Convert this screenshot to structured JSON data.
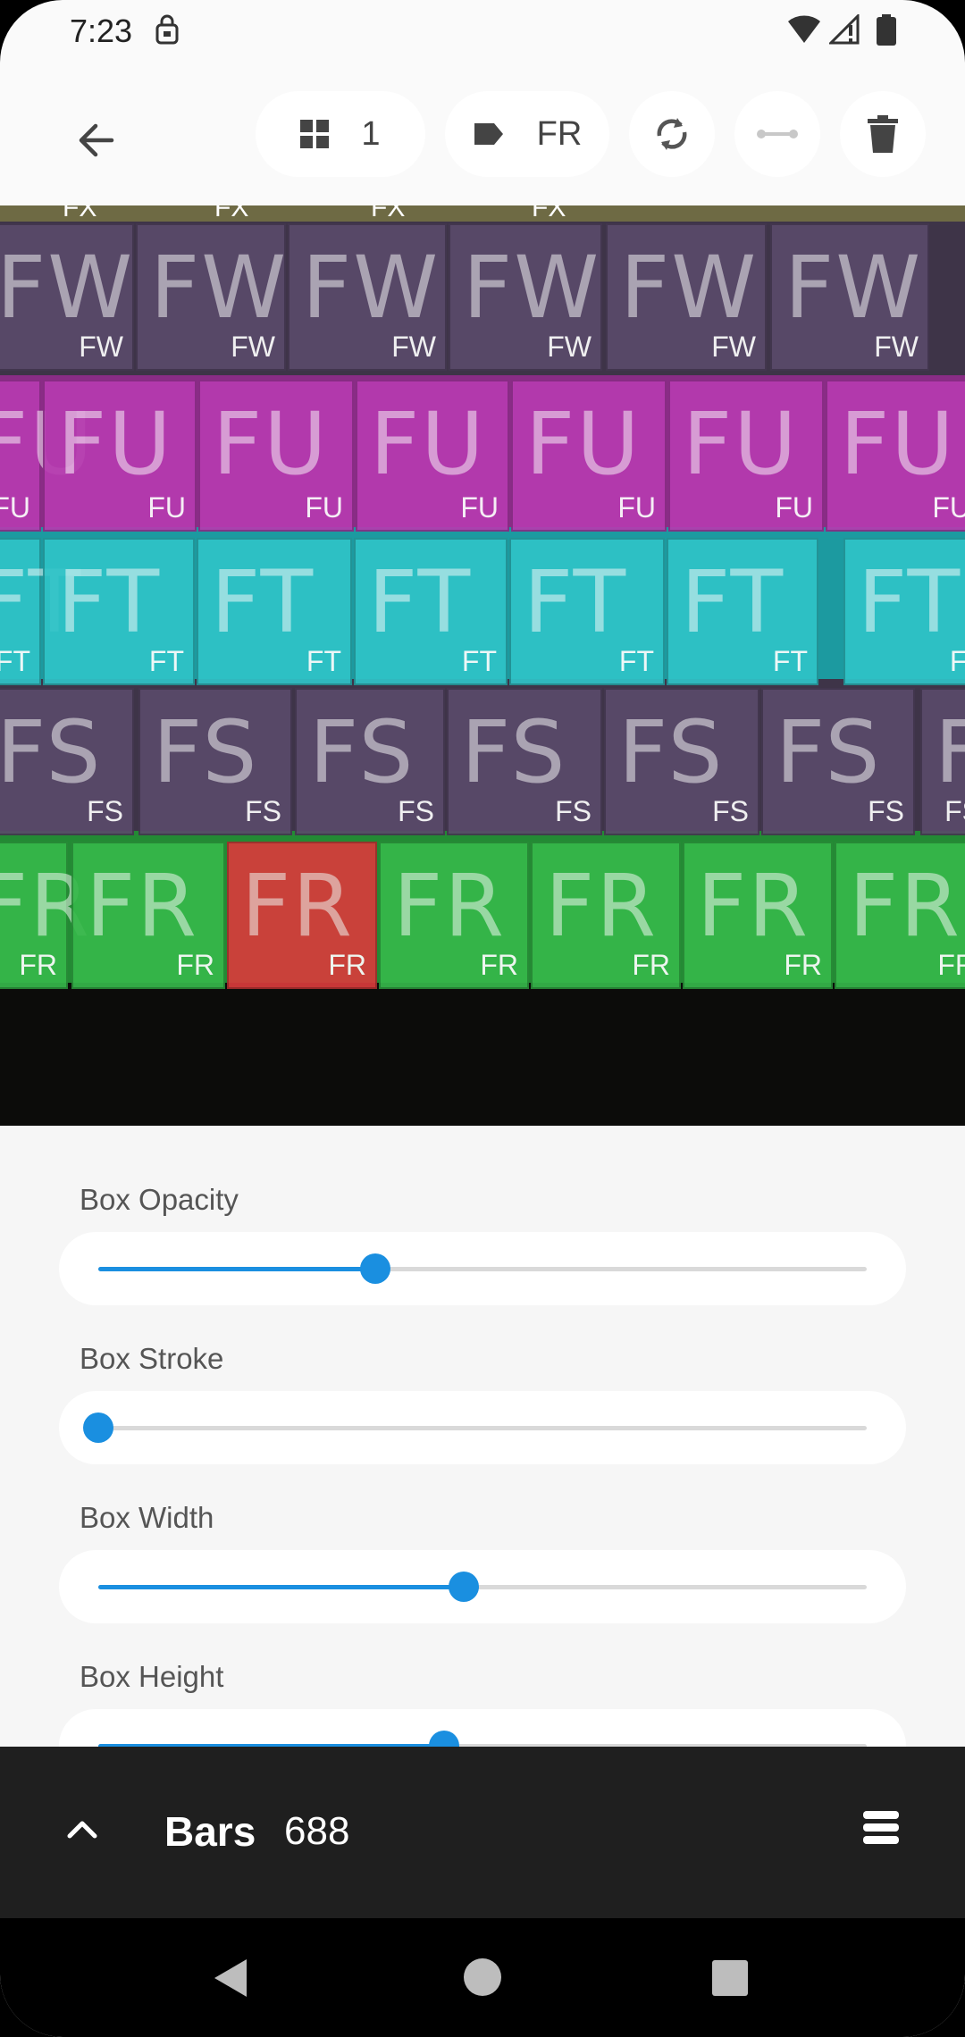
{
  "status_bar": {
    "time": "7:23"
  },
  "toolbar": {
    "grid_count": "1",
    "tag_label": "FR"
  },
  "photo": {
    "rows": [
      {
        "label": "FX",
        "color": "#c9c06a"
      },
      {
        "label": "FW",
        "color": "#5a4a6a"
      },
      {
        "label": "FU",
        "color": "#b63bb0"
      },
      {
        "label": "FT",
        "color": "#2fc4c8"
      },
      {
        "label": "FS",
        "color": "#5a4a6a"
      },
      {
        "label": "FR",
        "color": "#36b84a",
        "selected_color": "#d83b3b"
      }
    ]
  },
  "controls": {
    "opacity": {
      "label": "Box Opacity",
      "value": 0.36
    },
    "stroke": {
      "label": "Box Stroke",
      "value": 0.0
    },
    "width": {
      "label": "Box Width",
      "value": 0.475
    },
    "height": {
      "label": "Box Height",
      "value": 0.45
    }
  },
  "bottom_panel": {
    "title": "Bars",
    "count": "688"
  }
}
